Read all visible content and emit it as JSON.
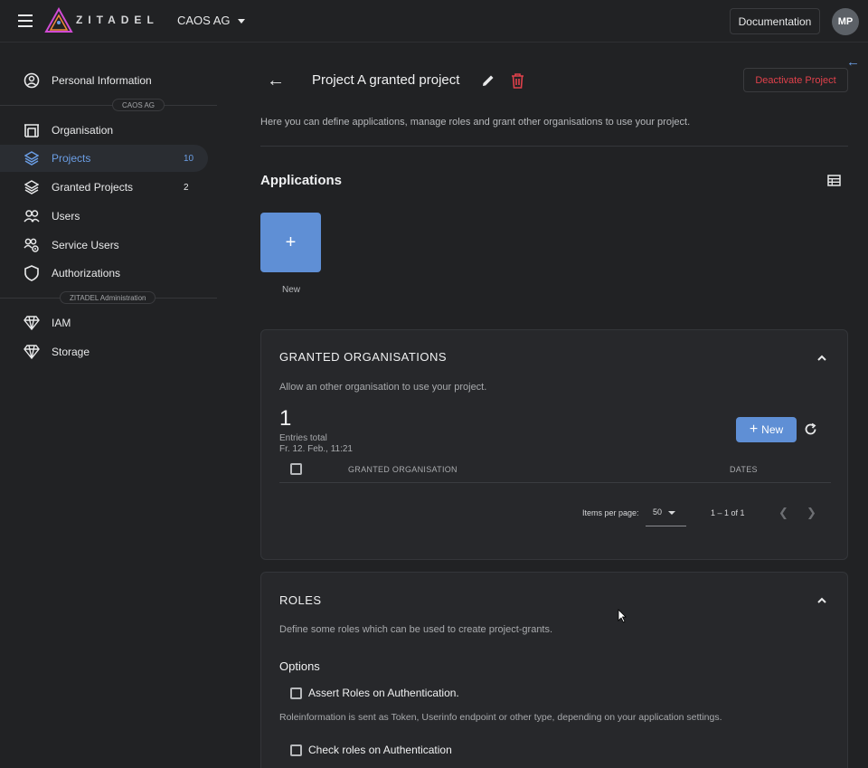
{
  "header": {
    "logo_text": "ZITADEL",
    "org_name": "CAOS AG",
    "documentation_label": "Documentation",
    "avatar_initials": "MP"
  },
  "sidebar": {
    "personal_information": "Personal Information",
    "section_org": "CAOS AG",
    "items": [
      {
        "label": "Organisation",
        "icon": "organisation-icon"
      },
      {
        "label": "Projects",
        "count": "10",
        "icon": "layers-icon"
      },
      {
        "label": "Granted Projects",
        "count": "2",
        "icon": "layers-icon"
      },
      {
        "label": "Users",
        "icon": "users-icon"
      },
      {
        "label": "Service Users",
        "icon": "service-users-icon"
      },
      {
        "label": "Authorizations",
        "icon": "shield-icon"
      }
    ],
    "section_admin": "ZITADEL Administration",
    "admin_items": [
      {
        "label": "IAM",
        "icon": "diamond-icon"
      },
      {
        "label": "Storage",
        "icon": "diamond-icon"
      }
    ]
  },
  "page": {
    "title": "Project A granted project",
    "deactivate_label": "Deactivate Project",
    "description": "Here you can define applications, manage roles and grant other organisations to use your project."
  },
  "applications": {
    "title": "Applications",
    "new_label": "New"
  },
  "granted_orgs": {
    "title": "GRANTED ORGANISATIONS",
    "description": "Allow an other organisation to use your project.",
    "total": "1",
    "total_label": "Entries total",
    "date": "Fr. 12. Feb., 11:21",
    "new_button": "New",
    "columns": [
      "GRANTED ORGANISATION",
      "DATES"
    ],
    "items_per_page_label": "Items per page:",
    "items_per_page": "50",
    "range": "1 – 1 of 1"
  },
  "roles": {
    "title": "ROLES",
    "description": "Define some roles which can be used to create project-grants.",
    "options_label": "Options",
    "assert_roles": "Assert Roles on Authentication.",
    "roles_note": "Roleinformation is sent as Token, Userinfo endpoint or other type, depending on your application settings.",
    "check_roles": "Check roles on Authentication"
  },
  "colors": {
    "accent": "#5f8fd5",
    "danger": "#e0414b",
    "background": "#212224"
  }
}
